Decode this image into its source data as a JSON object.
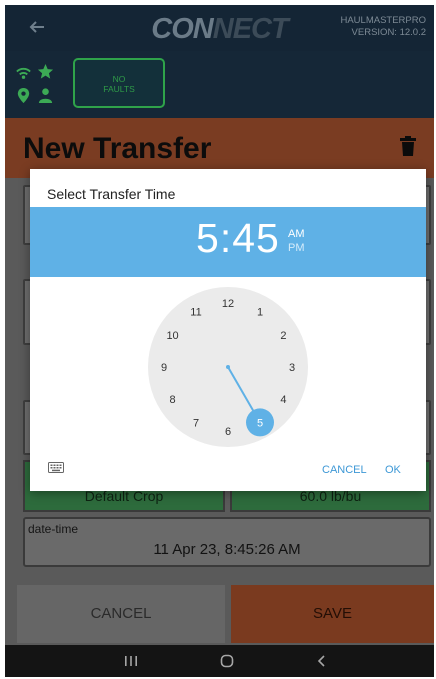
{
  "app": {
    "brand_co": "CON",
    "brand_rest": "NECT",
    "product": "HAULMASTERPRO",
    "version": "VERSION: 12.0.2"
  },
  "status": {
    "faults_line1": "NO",
    "faults_line2": "FAULTS"
  },
  "page": {
    "title": "New Transfer"
  },
  "form": {
    "crop_value": "Default Crop",
    "weight_value": "60.0 lb/bu",
    "datetime_label": "date-time",
    "datetime_value": "11 Apr 23, 8:45:26 AM"
  },
  "buttons": {
    "cancel": "CANCEL",
    "save": "SAVE"
  },
  "dialog": {
    "title": "Select Transfer Time",
    "hour": "5",
    "separator": ":",
    "minute": "45",
    "am": "AM",
    "pm": "PM",
    "selected_period": "AM",
    "selected_hour": 5,
    "clock_numbers": [
      "12",
      "1",
      "2",
      "3",
      "4",
      "5",
      "6",
      "7",
      "8",
      "9",
      "10",
      "11"
    ],
    "cancel": "CANCEL",
    "ok": "OK"
  },
  "colors": {
    "accent": "#5fb1e6",
    "status_green": "#2fa34a",
    "title_bar": "#7a3c22"
  },
  "icons": [
    "back-arrow-icon",
    "wifi-icon",
    "star-icon",
    "location-pin-icon",
    "person-icon",
    "trash-icon",
    "keyboard-icon",
    "recent-apps-icon",
    "home-icon",
    "back-icon"
  ]
}
